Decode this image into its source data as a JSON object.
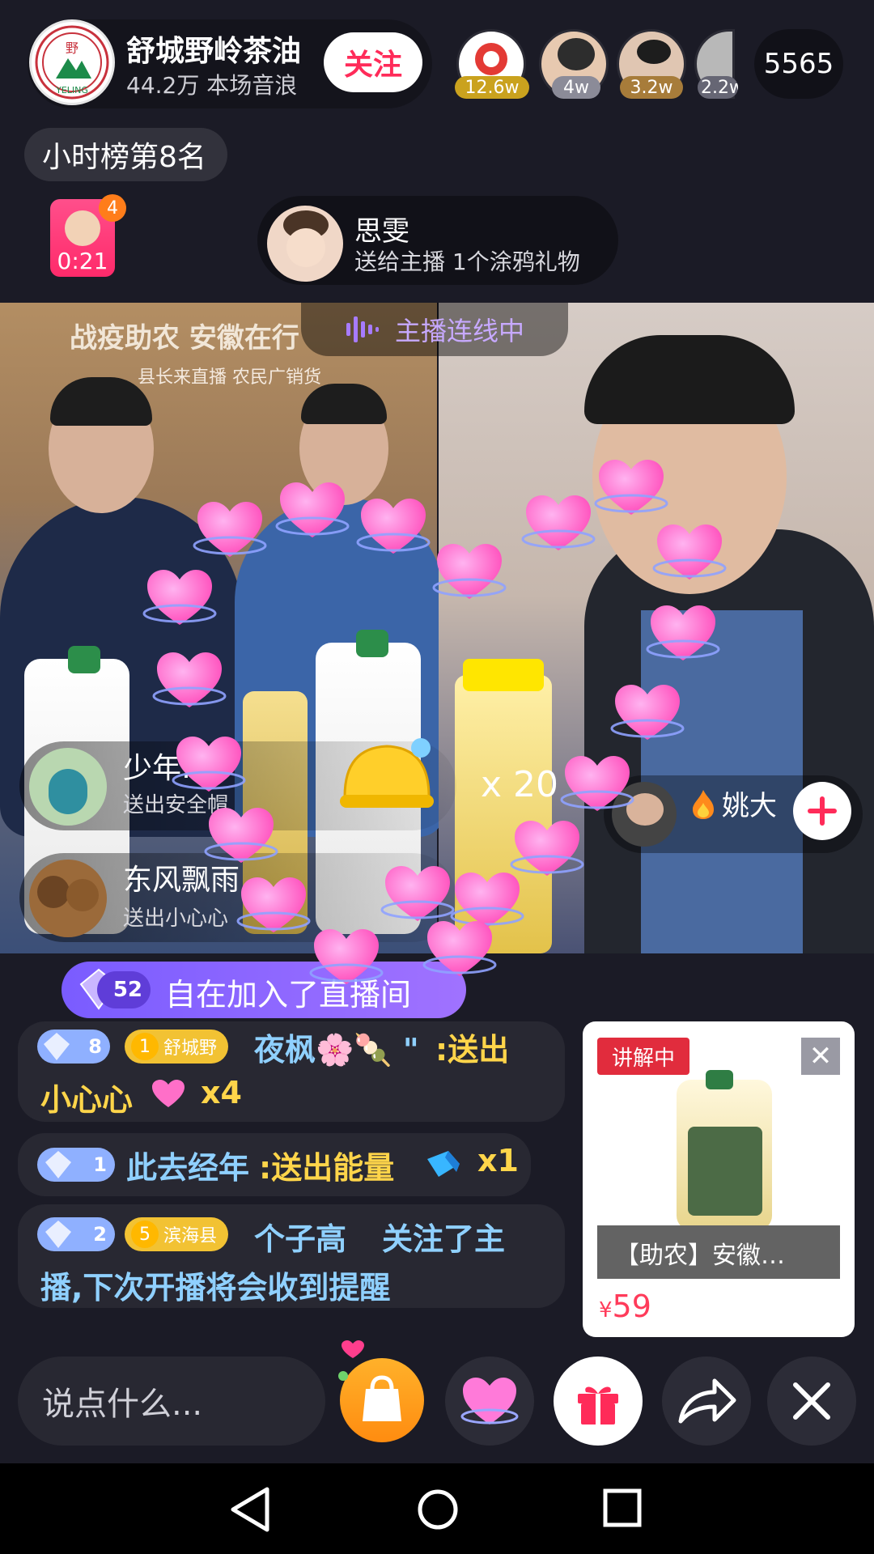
{
  "host": {
    "name": "舒城野岭茶油",
    "subtitle": "44.2万 本场音浪",
    "follow_label": "关注",
    "logo_text": "YELING"
  },
  "top_viewers": [
    {
      "badge": "12.6w",
      "badge_color": "#caa21e"
    },
    {
      "badge": "4w",
      "badge_color": "#8b8b98"
    },
    {
      "badge": "3.2w",
      "badge_color": "#a77c3a"
    },
    {
      "badge": "2.2w",
      "badge_color": "#666674"
    }
  ],
  "viewer_count": "5565",
  "rank_label": "小时榜第8名",
  "gift_badge": {
    "count": "4",
    "timer": "0:21"
  },
  "gift_notice": {
    "name": "思雯",
    "text": "送给主播 1个涂鸦礼物"
  },
  "video": {
    "link_label": "主播连线中",
    "banner_title": "战疫助农  安徽在行",
    "banner_sub": "县长来直播  农民广销货"
  },
  "gift_rows": [
    {
      "name": "少年…",
      "desc": "送出安全帽"
    },
    {
      "name": "东风飘雨",
      "desc": "送出小心心"
    }
  ],
  "multiplier": "x 20",
  "guest": {
    "name": "姚大"
  },
  "join": {
    "level": "52",
    "text": "自在加入了直播间"
  },
  "chat": [
    {
      "level": "8",
      "club": "舒城野",
      "club_level": "1",
      "user": "夜枫🌸🍡 \"",
      "action": ":送出",
      "action2": "小心心",
      "count": "x4"
    },
    {
      "level": "1",
      "user": "此去经年",
      "action": ":送出能量",
      "count": "x1"
    },
    {
      "level": "2",
      "club": "滨海县",
      "club_level": "5",
      "user": "个子高",
      "text1": "关注了主",
      "text2": "播,下次开播将会收到提醒"
    }
  ],
  "product": {
    "status": "讲解中",
    "close_label": "✕",
    "title": "【助农】安徽…",
    "currency": "¥",
    "price": "59"
  },
  "bottom": {
    "input_placeholder": "说点什么..."
  }
}
